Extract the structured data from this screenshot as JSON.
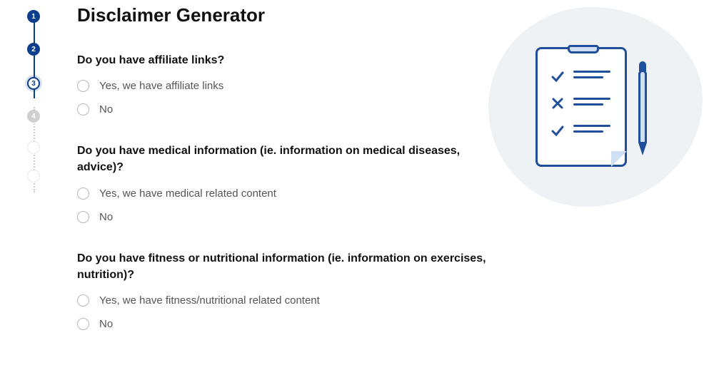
{
  "title": "Disclaimer Generator",
  "stepper": {
    "s1": "1",
    "s2": "2",
    "s3": "3",
    "s4": "4"
  },
  "questions": [
    {
      "label": "Do you have affiliate links?",
      "yes": "Yes, we have affiliate links",
      "no": "No"
    },
    {
      "label": "Do you have medical information (ie. information on medical diseases, advice)?",
      "yes": "Yes, we have medical related content",
      "no": "No"
    },
    {
      "label": "Do you have fitness or nutritional information (ie. information on exercises, nutrition)?",
      "yes": "Yes, we have fitness/nutritional related content",
      "no": "No"
    }
  ]
}
